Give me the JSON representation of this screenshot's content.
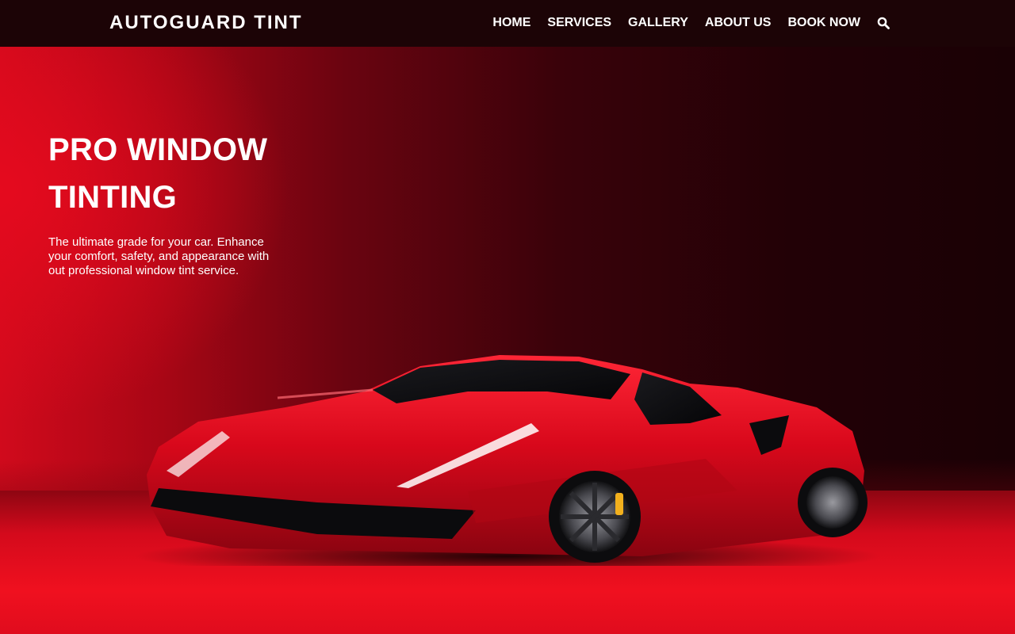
{
  "header": {
    "brand": "AUTOGUARD TINT",
    "nav": [
      {
        "label": "HOME"
      },
      {
        "label": "SERVICES"
      },
      {
        "label": "GALLERY"
      },
      {
        "label": "ABOUT US"
      },
      {
        "label": "BOOK NOW"
      }
    ],
    "search_icon": "search-icon"
  },
  "hero": {
    "title": "PRO WINDOW TINTING",
    "description": "The ultimate grade for your car. Enhance your comfort, safety, and appearance with out professional window tint service.",
    "image": "red-sports-car"
  },
  "colors": {
    "header_bg": "#1c0406",
    "accent_red": "#e00c1e",
    "dark_red": "#220106",
    "text": "#ffffff"
  }
}
